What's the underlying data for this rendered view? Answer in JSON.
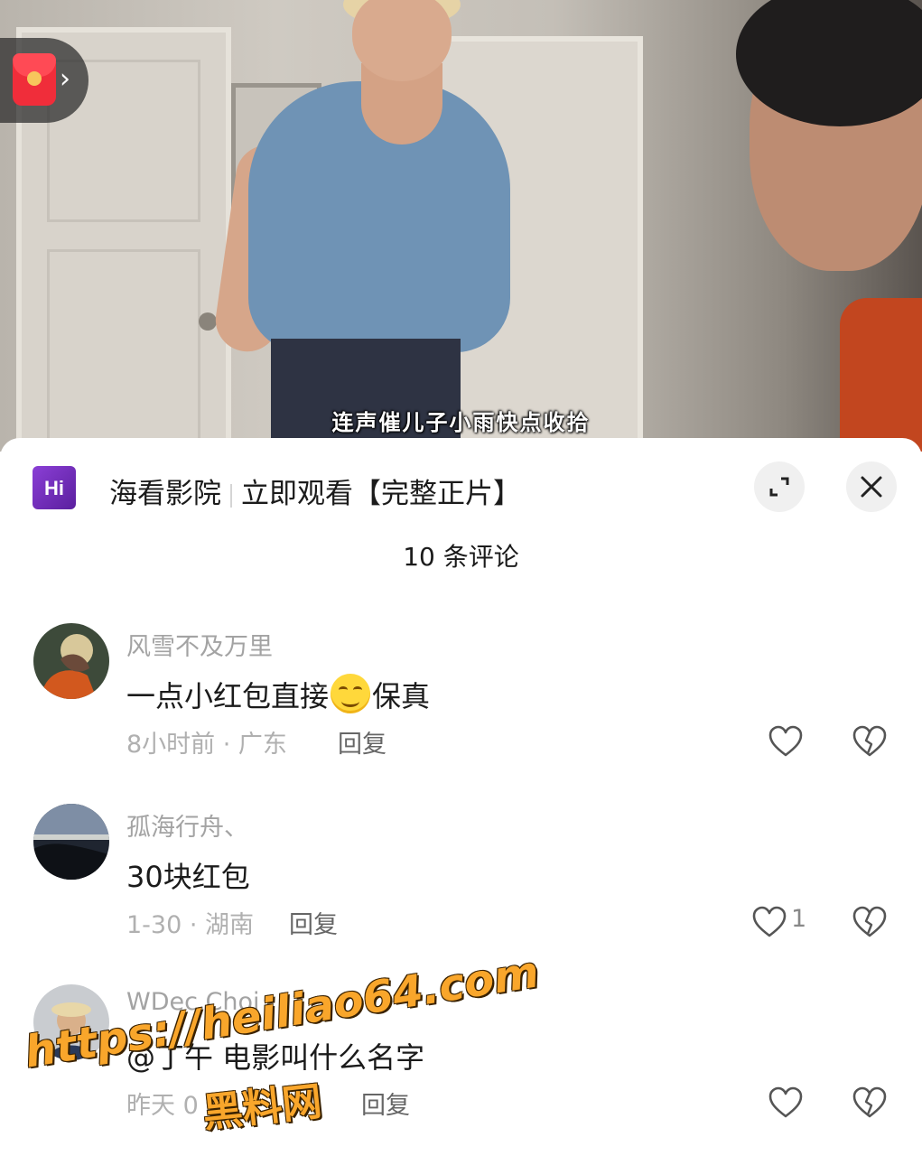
{
  "video": {
    "subtitle": "连声催儿子小雨快点收拾"
  },
  "floating": {
    "redpacket_icon": "red-envelope-icon",
    "chevron": "›"
  },
  "sheet": {
    "app_name": "海看影院",
    "promo": "立即观看【完整正片】",
    "expand_icon": "expand-icon",
    "close_icon": "close-icon",
    "comment_count": "10 条评论"
  },
  "comments": [
    {
      "user": "风雪不及万里",
      "text_before": "一点小红包直接",
      "emoji": "grin-emoji",
      "text_after": "保真",
      "meta": "8小时前 · 广东",
      "reply": "回复",
      "likes": ""
    },
    {
      "user": "孤海行舟、",
      "text_before": "30块红包",
      "emoji": "",
      "text_after": "",
      "meta": "1-30 · 湖南",
      "reply": "回复",
      "likes": "1"
    },
    {
      "user": "WDec.Choi",
      "text_before": "@丁午 电影叫什么名字",
      "emoji": "",
      "text_after": "",
      "meta": "昨天 0",
      "reply": "回复",
      "likes": ""
    }
  ],
  "watermark": {
    "url": "https://heiliao64.com",
    "name": "黑料网"
  },
  "colors": {
    "sheet_bg": "#ffffff",
    "username": "#a3a3a3",
    "watermark": "#f9a62b",
    "redpacket": "#f02d3a",
    "logo": "#7b35c8"
  }
}
